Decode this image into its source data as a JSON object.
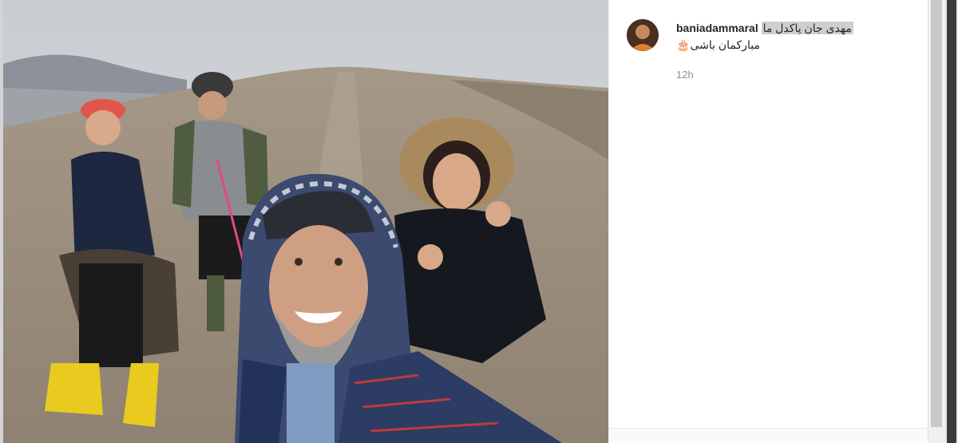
{
  "post": {
    "username": "baniadammaral",
    "caption_line1": "مهدی جان پاکدل ما",
    "caption_line2": "مبارکمان باشی",
    "caption_emoji": "🎂",
    "timestamp": "12h"
  },
  "photo": {
    "subject": "selfie of four hikers on a hill"
  },
  "colors": {
    "text_primary": "#262626",
    "text_secondary": "#8e8e8e",
    "highlight": "#cfcfcf"
  }
}
